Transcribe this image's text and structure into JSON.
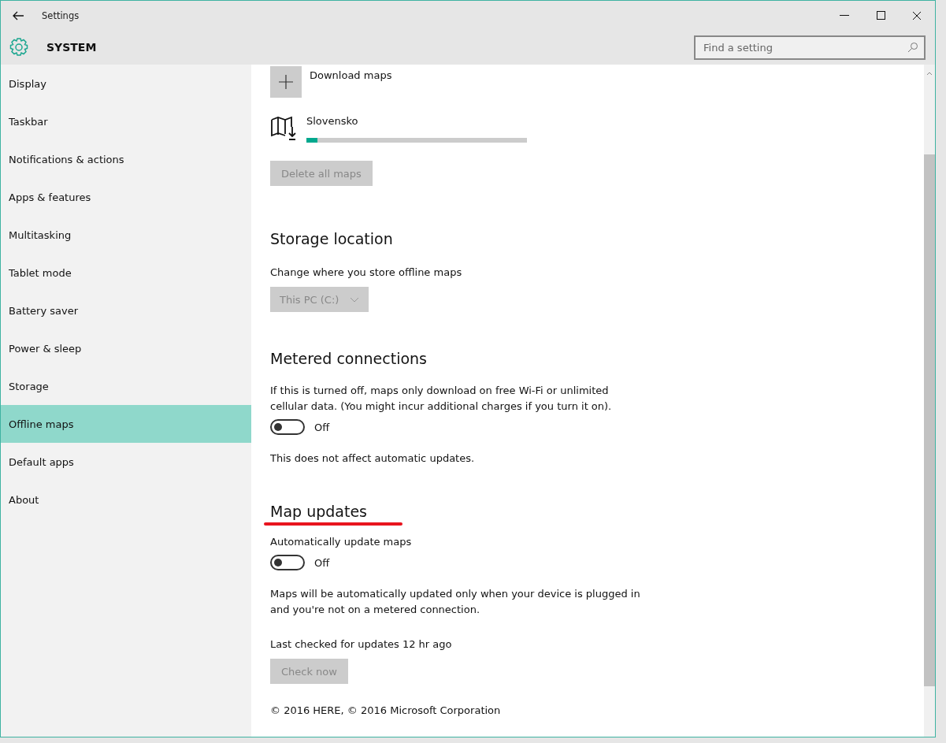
{
  "window": {
    "title": "Settings"
  },
  "header": {
    "title": "SYSTEM",
    "search": {
      "placeholder": "Find a setting"
    }
  },
  "sidebar": {
    "items": [
      {
        "label": "Display",
        "selected": false
      },
      {
        "label": "Taskbar",
        "selected": false
      },
      {
        "label": "Notifications & actions",
        "selected": false
      },
      {
        "label": "Apps & features",
        "selected": false
      },
      {
        "label": "Multitasking",
        "selected": false
      },
      {
        "label": "Tablet mode",
        "selected": false
      },
      {
        "label": "Battery saver",
        "selected": false
      },
      {
        "label": "Power & sleep",
        "selected": false
      },
      {
        "label": "Storage",
        "selected": false
      },
      {
        "label": "Offline maps",
        "selected": true
      },
      {
        "label": "Default apps",
        "selected": false
      },
      {
        "label": "About",
        "selected": false
      }
    ]
  },
  "content": {
    "download_label": "Download maps",
    "map": {
      "name": "Slovensko",
      "level": 0.05
    },
    "delete_button": {
      "label": "Delete all maps",
      "disabled": true
    },
    "sections": [
      {
        "kind": "dropdown",
        "heading": "Storage location",
        "description": "Change where you store offline maps",
        "value": "This PC (C:)",
        "disabled": true
      },
      {
        "kind": "toggle",
        "heading": "Metered connections",
        "description": "If this is turned off, maps only download on free Wi-Fi or unlimited cellular data. (You might incur additional charges if you turn it on).",
        "on": false,
        "state_label": "Off",
        "note": "This does not affect automatic updates."
      },
      {
        "kind": "toggle",
        "heading": "Map updates",
        "underlined": true,
        "description": "Automatically update maps",
        "on": false,
        "state_label": "Off",
        "note": "Maps will be automatically updated only when your device is plugged in and you're not on a metered connection.",
        "last_checked": "Last checked for updates 12 hr ago",
        "button": {
          "label": "Check now",
          "disabled": true
        }
      }
    ],
    "copyright": "© 2016 HERE, © 2016 Microsoft Corporation"
  }
}
